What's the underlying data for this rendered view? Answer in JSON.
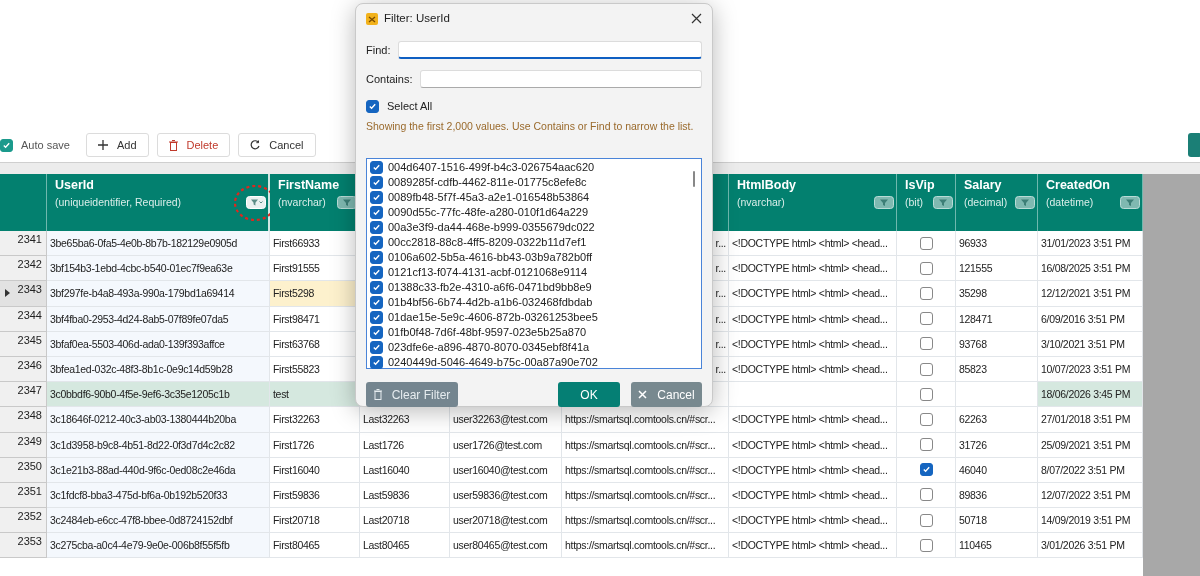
{
  "toolbar": {
    "auto_save": {
      "label": "Auto save",
      "checked": true
    },
    "buttons": [
      {
        "label": "Add",
        "kind": "add"
      },
      {
        "label": "Delete",
        "kind": "delete"
      },
      {
        "label": "Cancel",
        "kind": "cancel"
      }
    ]
  },
  "grid": {
    "columns": [
      {
        "name": "UserId",
        "type": "(uniqueidentifier, Required)",
        "circled": true
      },
      {
        "name": "FirstName",
        "type": "(nvarchar)",
        "circled": false
      },
      {},
      {},
      {},
      {
        "name": "HtmlBody",
        "type": "(nvarchar)",
        "circled": false
      },
      {
        "name": "IsVip",
        "type": "(bit)",
        "circled": false
      },
      {
        "name": "Salary",
        "type": "(decimal)",
        "circled": false
      },
      {
        "name": "CreatedOn",
        "type": "(datetime)",
        "circled": false
      }
    ],
    "rows": [
      {
        "num": "2341",
        "selected": false,
        "new": false,
        "user_id": "3be65ba6-0fa5-4e0b-8b7b-182129e0905d",
        "first_name": "First66933",
        "url": "r...",
        "html_body": "<!DOCTYPE html> <html> <head...",
        "is_vip": false,
        "salary": "96933",
        "created_on": "31/01/2023 3:51 PM"
      },
      {
        "num": "2342",
        "selected": false,
        "new": false,
        "user_id": "3bf154b3-1ebd-4cbc-b540-01ec7f9ea63e",
        "first_name": "First91555",
        "url": "r...",
        "html_body": "<!DOCTYPE html> <html> <head...",
        "is_vip": false,
        "salary": "121555",
        "created_on": "16/08/2025 3:51 PM"
      },
      {
        "num": "2343",
        "selected": true,
        "new": false,
        "user_id": "3bf297fe-b4a8-493a-990a-179bd1a69414",
        "first_name": "First5298",
        "url": "r...",
        "html_body": "<!DOCTYPE html> <html> <head...",
        "is_vip": false,
        "salary": "35298",
        "created_on": "12/12/2021 3:51 PM"
      },
      {
        "num": "2344",
        "selected": false,
        "new": false,
        "user_id": "3bf4fba0-2953-4d24-8ab5-07f89fe07da5",
        "first_name": "First98471",
        "url": "r...",
        "html_body": "<!DOCTYPE html> <html> <head...",
        "is_vip": false,
        "salary": "128471",
        "created_on": "6/09/2016 3:51 PM"
      },
      {
        "num": "2345",
        "selected": false,
        "new": false,
        "user_id": "3bfaf0ea-5503-406d-ada0-139f393affce",
        "first_name": "First63768",
        "url": "r...",
        "html_body": "<!DOCTYPE html> <html> <head...",
        "is_vip": false,
        "salary": "93768",
        "created_on": "3/10/2021 3:51 PM"
      },
      {
        "num": "2346",
        "selected": false,
        "new": false,
        "user_id": "3bfea1ed-032c-48f3-8b1c-0e9c14d59b28",
        "first_name": "First55823",
        "url": "r...",
        "html_body": "<!DOCTYPE html> <html> <head...",
        "is_vip": false,
        "salary": "85823",
        "created_on": "10/07/2023 3:51 PM"
      },
      {
        "num": "2347",
        "selected": false,
        "new": true,
        "user_id": "3c0bbdf6-90b0-4f5e-9ef6-3c35e1205c1b",
        "first_name": "test",
        "is_vip": false,
        "created_on": "18/06/2026 3:45 PM"
      },
      {
        "num": "2348",
        "selected": false,
        "new": false,
        "user_id": "3c18646f-0212-40c3-ab03-1380444b20ba",
        "first_name": "First32263",
        "last_name": "Last32263",
        "email": "user32263@test.com",
        "url": "https://smartsql.comtools.cn/#scr...",
        "html_body": "<!DOCTYPE html> <html> <head...",
        "is_vip": false,
        "salary": "62263",
        "created_on": "27/01/2018 3:51 PM"
      },
      {
        "num": "2349",
        "selected": false,
        "new": false,
        "user_id": "3c1d3958-b9c8-4b51-8d22-0f3d7d4c2c82",
        "first_name": "First1726",
        "last_name": "Last1726",
        "email": "user1726@test.com",
        "url": "https://smartsql.comtools.cn/#scr...",
        "html_body": "<!DOCTYPE html> <html> <head...",
        "is_vip": false,
        "salary": "31726",
        "created_on": "25/09/2021 3:51 PM"
      },
      {
        "num": "2350",
        "selected": false,
        "new": false,
        "user_id": "3c1e21b3-88ad-440d-9f6c-0ed08c2e46da",
        "first_name": "First16040",
        "last_name": "Last16040",
        "email": "user16040@test.com",
        "url": "https://smartsql.comtools.cn/#scr...",
        "html_body": "<!DOCTYPE html> <html> <head...",
        "is_vip": true,
        "salary": "46040",
        "created_on": "8/07/2022 3:51 PM"
      },
      {
        "num": "2351",
        "selected": false,
        "new": false,
        "user_id": "3c1fdcf8-bba3-475d-bf6a-0b192b520f33",
        "first_name": "First59836",
        "last_name": "Last59836",
        "email": "user59836@test.com",
        "url": "https://smartsql.comtools.cn/#scr...",
        "html_body": "<!DOCTYPE html> <html> <head...",
        "is_vip": false,
        "salary": "89836",
        "created_on": "12/07/2022 3:51 PM"
      },
      {
        "num": "2352",
        "selected": false,
        "new": false,
        "user_id": "3c2484eb-e6cc-47f8-bbee-0d8724152dbf",
        "first_name": "First20718",
        "last_name": "Last20718",
        "email": "user20718@test.com",
        "url": "https://smartsql.comtools.cn/#scr...",
        "html_body": "<!DOCTYPE html> <html> <head...",
        "is_vip": false,
        "salary": "50718",
        "created_on": "14/09/2019 3:51 PM"
      },
      {
        "num": "2353",
        "selected": false,
        "new": false,
        "user_id": "3c275cba-a0c4-4e79-9e0e-006b8f55f5fb",
        "first_name": "First80465",
        "last_name": "Last80465",
        "email": "user80465@test.com",
        "url": "https://smartsql.comtools.cn/#scr...",
        "html_body": "<!DOCTYPE html> <html> <head...",
        "is_vip": false,
        "salary": "110465",
        "created_on": "3/01/2026 3:51 PM"
      }
    ]
  },
  "dialog": {
    "title": "Filter: UserId",
    "find": {
      "label": "Find:",
      "focused": true
    },
    "contains": {
      "label": "Contains:"
    },
    "select_all": {
      "label": "Select All",
      "checked": true
    },
    "hint": "Showing the first 2,000 values. Use Contains or Find to narrow the list.",
    "values": [
      {
        "text": "004d6407-1516-499f-b4c3-026754aac620",
        "checked": true
      },
      {
        "text": "0089285f-cdfb-4462-811e-01775c8efe8c",
        "checked": true
      },
      {
        "text": "0089fb48-5f7f-45a3-a2e1-016548b53864",
        "checked": true
      },
      {
        "text": "0090d55c-77fc-48fe-a280-010f1d64a229",
        "checked": true
      },
      {
        "text": "00a3e3f9-da44-468e-b999-0355679dc022",
        "checked": true
      },
      {
        "text": "00cc2818-88c8-4ff5-8209-0322b11d7ef1",
        "checked": true
      },
      {
        "text": "0106a602-5b5a-4616-bb43-03b9a782b0ff",
        "checked": true
      },
      {
        "text": "0121cf13-f074-4131-acbf-0121068e9114",
        "checked": true
      },
      {
        "text": "01388c33-fb2e-4310-a6f6-0471bd9bb8e9",
        "checked": true
      },
      {
        "text": "01b4bf56-6b74-4d2b-a1b6-032468fdbdab",
        "checked": true
      },
      {
        "text": "01dae15e-5e9c-4606-872b-03261253bee5",
        "checked": true
      },
      {
        "text": "01fb0f48-7d6f-48bf-9597-023e5b25a870",
        "checked": true
      },
      {
        "text": "023dfe6e-a896-4870-8070-0345ebf8f41a",
        "checked": true
      },
      {
        "text": "0240449d-5046-4649-b75c-00a87a90e702",
        "checked": true
      }
    ],
    "buttons": [
      {
        "label": "Clear Filter",
        "kind": "clear"
      },
      {
        "label": "OK",
        "kind": "ok"
      },
      {
        "label": "Cancel",
        "kind": "cancel"
      }
    ]
  }
}
